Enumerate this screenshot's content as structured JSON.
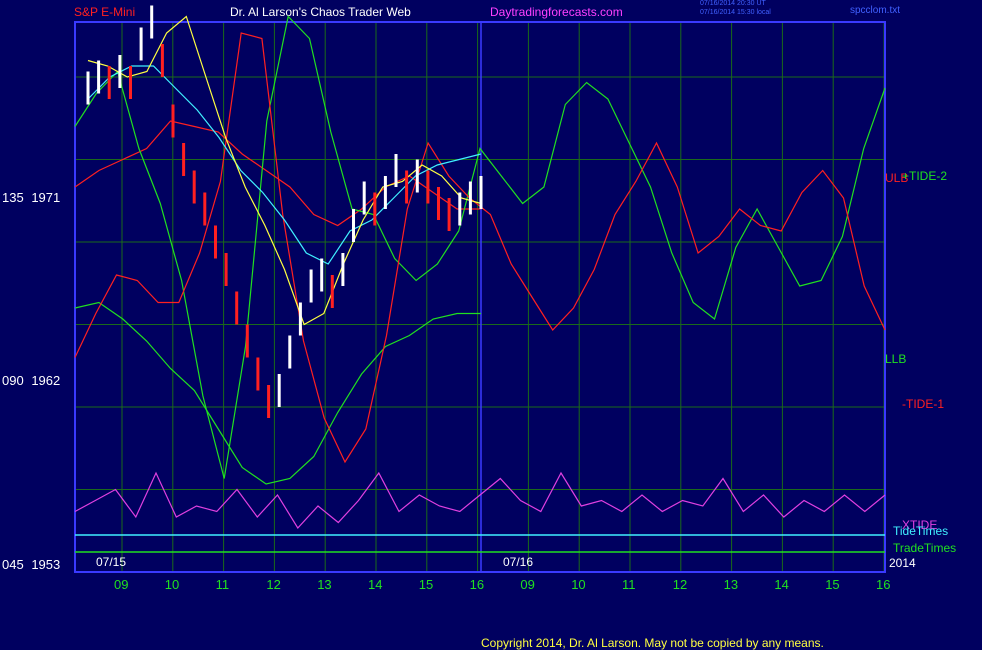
{
  "header": {
    "instrument": "S&P E-Mini",
    "site": "Dr. Al Larson's Chaos Trader Web",
    "domain": "Daytradingforecasts.com",
    "ts_ut": "07/16/2014 20:30 UT",
    "ts_local": "07/16/2014 15:30 local",
    "file": "spcclom.txt"
  },
  "colors": {
    "background": "#000060",
    "frame": "#3a3aff",
    "grid": "#1a6a1a",
    "white_label": "#ffffff",
    "red": "#ff2020",
    "green": "#20e020",
    "cyan": "#40f0ff",
    "magenta": "#e040e0",
    "yellow": "#ffff40",
    "price_up": "#ffffff",
    "price_down": "#ff2020",
    "header_red": "#ff2020",
    "header_white": "#ffffff",
    "header_magenta": "#ff40ff",
    "header_blue": "#4060ff"
  },
  "chart_data": {
    "type": "line",
    "y_axis": {
      "ticks": [
        {
          "label": "135",
          "price": "1971",
          "value": 1971
        },
        {
          "label": "090",
          "price": "1962",
          "value": 1962
        },
        {
          "label": "045",
          "price": "1953",
          "value": 1953
        }
      ],
      "range": [
        1953,
        1973
      ]
    },
    "x_axis": {
      "hours": [
        "09",
        "10",
        "11",
        "12",
        "13",
        "14",
        "15",
        "16",
        "09",
        "10",
        "11",
        "12",
        "13",
        "14",
        "15",
        "16"
      ],
      "dates": [
        "07/15",
        "07/16"
      ],
      "year": "2014"
    },
    "series_labels": {
      "ulb": "ULB",
      "tide2": "+TIDE-2",
      "llb": "LLB",
      "tide1": "-TIDE-1",
      "xtide": "XTIDE",
      "tidetimes": "TideTimes",
      "tradetimes": "TradeTimes"
    },
    "series": [
      {
        "name": "ULB",
        "color": "red",
        "y": [
          1967,
          1967.6,
          1968,
          1968.4,
          1969.4,
          1969.2,
          1969,
          1968.2,
          1967.6,
          1967,
          1966,
          1965.6,
          1966.2,
          1967,
          1967.4,
          1966.8,
          1966.2,
          1966.2
        ]
      },
      {
        "name": "LLB",
        "color": "green",
        "y": [
          1962.6,
          1962.8,
          1962.2,
          1961.4,
          1960.4,
          1959.6,
          1958.2,
          1956.8,
          1956.2,
          1956.4,
          1957.2,
          1958.8,
          1960.2,
          1961.2,
          1961.6,
          1962.2,
          1962.4,
          1962.4
        ]
      },
      {
        "name": "+TIDE-2",
        "color": "green",
        "y": [
          1969.2,
          1970.4,
          1971.2,
          1968.4,
          1966.4,
          1963.6,
          1959.4,
          1956.4,
          1961.2,
          1969.4,
          1973.2,
          1972.4,
          1969,
          1966.2,
          1966,
          1964.4,
          1963.6,
          1964.2,
          1965.4,
          1968.4,
          1967.4,
          1966.4,
          1967,
          1970,
          1970.8,
          1970.2,
          1968.6,
          1967,
          1964.6,
          1962.8,
          1962.2,
          1964.8,
          1966.2,
          1964.8,
          1963.4,
          1963.6,
          1965.2,
          1968.4,
          1970.6
        ]
      },
      {
        "name": "-TIDE-1",
        "color": "red",
        "y": [
          1960.8,
          1962.4,
          1963.8,
          1963.6,
          1962.8,
          1962.8,
          1964.6,
          1967.2,
          1972.6,
          1972.4,
          1966,
          1961.4,
          1958.6,
          1957,
          1958.2,
          1961.6,
          1966.2,
          1968.6,
          1967.4,
          1966.6,
          1966,
          1964.2,
          1963,
          1961.8,
          1962.6,
          1964,
          1966,
          1967.2,
          1968.6,
          1967,
          1964.6,
          1965.2,
          1966.2,
          1965.6,
          1965.4,
          1966.8,
          1967.6,
          1966.6,
          1963.4,
          1961.8
        ]
      },
      {
        "name": "MA-cyan",
        "color": "cyan",
        "y": [
          1970.2,
          1971,
          1971.4,
          1971.4,
          1970.6,
          1969.8,
          1968.8,
          1967.6,
          1966.8,
          1965.8,
          1964.6,
          1964.2,
          1965.4,
          1965.8,
          1966.6,
          1967.4,
          1967.8,
          1968,
          1968.2
        ]
      },
      {
        "name": "MA-yellow",
        "color": "yellow",
        "y": [
          1971.6,
          1971.4,
          1971,
          1971.2,
          1972.6,
          1973.2,
          1971,
          1968.8,
          1967,
          1965.6,
          1964,
          1962,
          1962.4,
          1964.2,
          1965.8,
          1967,
          1967.2,
          1967.8,
          1967.4,
          1966.6,
          1966.4
        ]
      },
      {
        "name": "XTIDE",
        "color": "magenta",
        "y": [
          1955.2,
          1955.6,
          1956,
          1955,
          1956.6,
          1955,
          1955.4,
          1955.2,
          1956,
          1955,
          1955.8,
          1954.6,
          1955.4,
          1954.8,
          1955.6,
          1956.6,
          1955.2,
          1955.8,
          1955.4,
          1955.2,
          1955.8,
          1956.4,
          1955.6,
          1955.2,
          1956.6,
          1955.4,
          1955.6,
          1955.2,
          1955.8,
          1955.2,
          1955.6,
          1955.4,
          1956.4,
          1955.2,
          1955.8,
          1955,
          1955.6,
          1955.2,
          1955.8,
          1955.2,
          1955.8
        ]
      }
    ],
    "grid": true
  },
  "footer": {
    "copyright": "Copyright 2014, Dr. Al Larson. May not be copied by any means."
  }
}
